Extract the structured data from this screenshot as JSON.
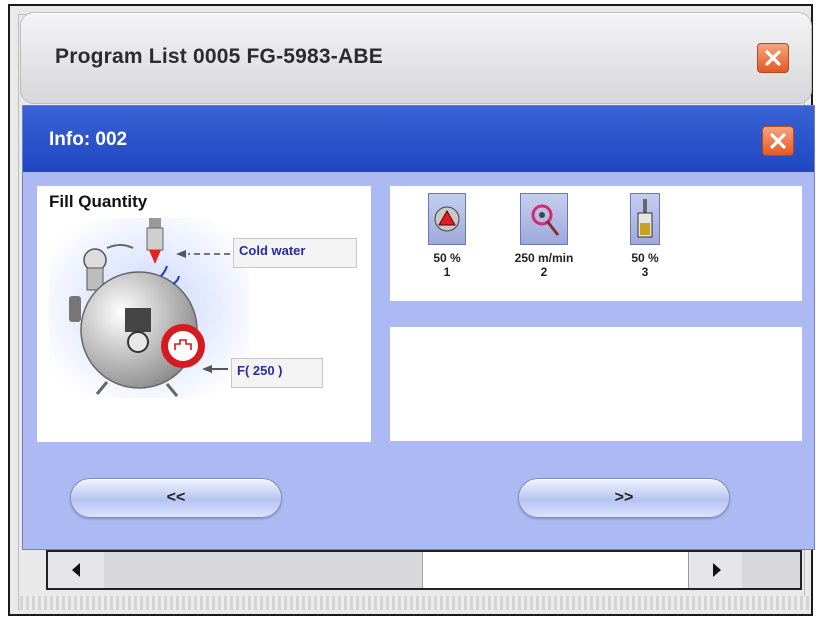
{
  "program_window": {
    "title": "Program List 0005  FG-5983-ABE",
    "close_icon": "close-icon"
  },
  "info_dialog": {
    "title": "Info: 002",
    "close_icon": "close-icon",
    "fill_quantity": {
      "title": "Fill Quantity",
      "water_label": "Cold water",
      "formula_label": "F( 250 )"
    },
    "parameters": [
      {
        "icon": "warning-triangle-icon",
        "value": "50 %",
        "number": "1"
      },
      {
        "icon": "rotation-speed-icon",
        "value": "250 m/min",
        "number": "2"
      },
      {
        "icon": "dosing-container-icon",
        "value": "50 %",
        "number": "3"
      }
    ],
    "nav": {
      "prev_label": "<<",
      "next_label": ">>"
    }
  },
  "colors": {
    "dialog_titlebar": "#2450c6",
    "dialog_body": "#adb9f3",
    "close_button": "#e35a26"
  }
}
